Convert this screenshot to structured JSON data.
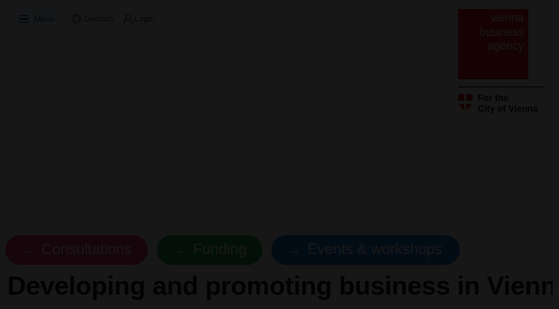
{
  "nav": {
    "menu_label": "Menu",
    "language_label": "Deutsch",
    "login_label": "Login"
  },
  "logo": {
    "line1": "vienna",
    "line2": "business",
    "line3": "agency",
    "brand_color": "#e2151c"
  },
  "city": {
    "line1": "For the",
    "line2": "City of Vienna"
  },
  "actions": [
    {
      "label": "Consultations",
      "color": "#e8357a"
    },
    {
      "label": "Funding",
      "color": "#14a04e"
    },
    {
      "label": "Events & workshops",
      "color": "#1b78d8"
    }
  ],
  "headline": "Developing and promoting business in Vienna.",
  "icons": {
    "menu": "hamburger-icon",
    "language": "globe-icon",
    "login": "person-icon",
    "action_arrow": "arrow-right-icon",
    "city_crest": "vienna-shield-icon"
  },
  "modal_overlay": true
}
